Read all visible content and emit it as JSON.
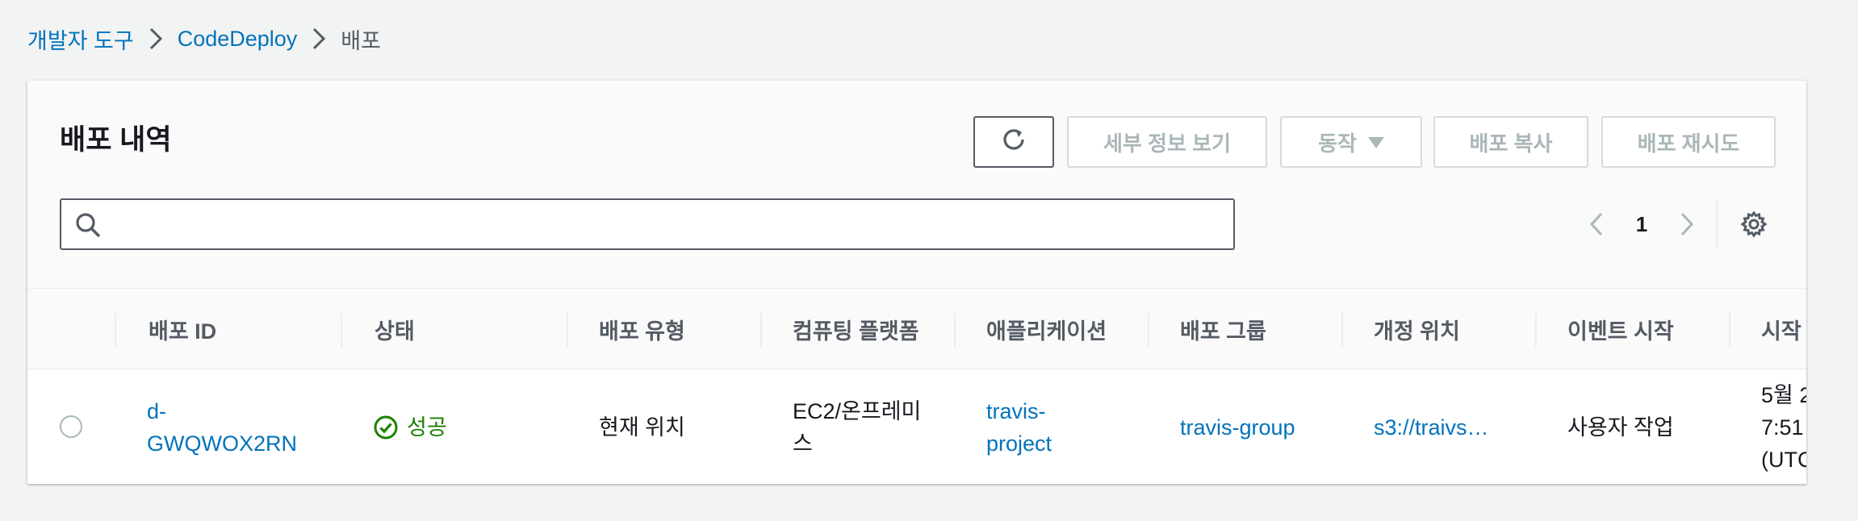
{
  "breadcrumb": {
    "items": [
      {
        "label": "개발자 도구"
      },
      {
        "label": "CodeDeploy"
      },
      {
        "label": "배포"
      }
    ]
  },
  "panel": {
    "title": "배포 내역",
    "buttons": {
      "refresh_icon": "refresh-icon",
      "details": "세부 정보 보기",
      "actions": "동작",
      "copy": "배포 복사",
      "retry": "배포 재시도"
    },
    "search": {
      "placeholder": "",
      "value": ""
    },
    "pagination": {
      "current_page": "1"
    }
  },
  "table": {
    "columns": [
      "배포 ID",
      "상태",
      "배포 유형",
      "컴퓨팅 플랫폼",
      "애플리케이션",
      "배포 그룹",
      "개정 위치",
      "이벤트 시작",
      "시작"
    ],
    "rows": [
      {
        "id_line1": "d-",
        "id_line2": "GWQWOX2RN",
        "status": "성공",
        "type": "현재 위치",
        "platform_line1": "EC2/온프레미",
        "platform_line2": "스",
        "application_line1": "travis-",
        "application_line2": "project",
        "group": "travis-group",
        "revision": "s3://traivs…",
        "event": "사용자 작업",
        "start_line1": "5월 2",
        "start_line2": "7:51",
        "start_line3": "(UTC"
      }
    ]
  },
  "colors": {
    "link": "#0073bb",
    "success": "#1d8102",
    "disabled_text": "#aab7b8",
    "background": "#f2f3f3"
  }
}
